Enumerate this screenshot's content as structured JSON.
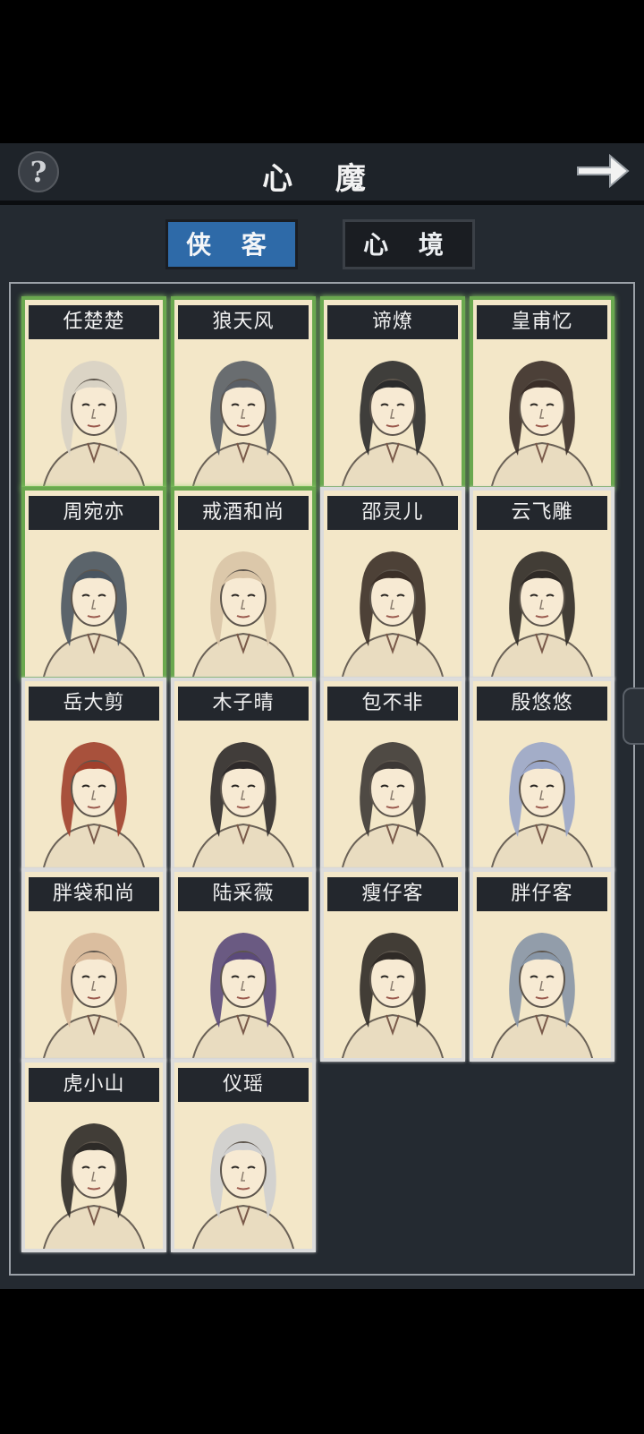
{
  "header": {
    "title": "心 魔",
    "help_label": "?"
  },
  "tabs": [
    {
      "label": "侠 客",
      "active": true
    },
    {
      "label": "心 境",
      "active": false
    }
  ],
  "colors": {
    "accent": "#2e6aa8",
    "unlocked_border": "#6aa84f",
    "card_bg": "#f3e7c8"
  },
  "characters": [
    {
      "name": "任楚楚",
      "unlocked": true,
      "hair": "#d8d2c4"
    },
    {
      "name": "狼天风",
      "unlocked": true,
      "hair": "#5a5f66"
    },
    {
      "name": "谛燎",
      "unlocked": true,
      "hair": "#2b2b2b"
    },
    {
      "name": "皇甫忆",
      "unlocked": true,
      "hair": "#3a2e28"
    },
    {
      "name": "周宛亦",
      "unlocked": true,
      "hair": "#4a5560"
    },
    {
      "name": "戒酒和尚",
      "unlocked": true,
      "hair": "#d9c4a6"
    },
    {
      "name": "邵灵儿",
      "unlocked": false,
      "hair": "#3b2f27"
    },
    {
      "name": "云飞雕",
      "unlocked": false,
      "hair": "#2f2a26"
    },
    {
      "name": "岳大剪",
      "unlocked": false,
      "hair": "#a0402c"
    },
    {
      "name": "木子晴",
      "unlocked": false,
      "hair": "#2e2a2a"
    },
    {
      "name": "包不非",
      "unlocked": false,
      "hair": "#3d3835"
    },
    {
      "name": "殷悠悠",
      "unlocked": false,
      "hair": "#9aa6c8"
    },
    {
      "name": "胖袋和尚",
      "unlocked": false,
      "hair": "#d8b99a"
    },
    {
      "name": "陆采薇",
      "unlocked": false,
      "hair": "#5b4a7a"
    },
    {
      "name": "瘦仔客",
      "unlocked": false,
      "hair": "#2f2a26"
    },
    {
      "name": "胖仔客",
      "unlocked": false,
      "hair": "#8795a6"
    },
    {
      "name": "虎小山",
      "unlocked": false,
      "hair": "#2d2a27"
    },
    {
      "name": "仪瑶",
      "unlocked": false,
      "hair": "#cfcfcf"
    }
  ]
}
